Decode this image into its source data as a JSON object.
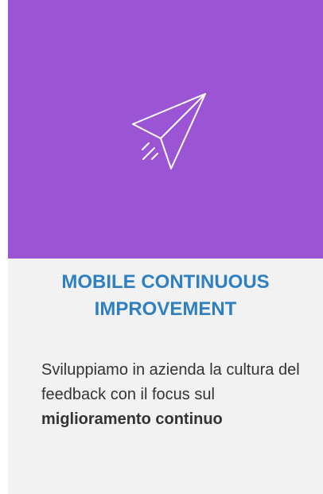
{
  "card": {
    "background": "#f2f2f2",
    "hero_color": "#9b54d3",
    "icon": "paper-plane-icon",
    "title_line1": "MOBILE CONTINUOUS",
    "title_line2": "IMPROVEMENT",
    "title_color": "#2f80c2",
    "desc_text": "Sviluppiamo in azienda la cultura del feedback con il focus sul ",
    "desc_bold": "miglioramento continuo"
  }
}
